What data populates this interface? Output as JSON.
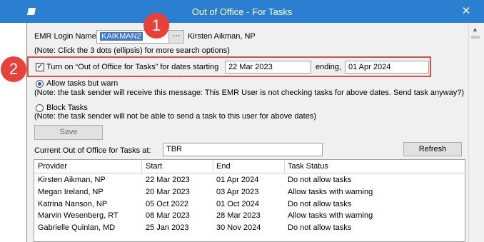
{
  "window": {
    "title": "Out of Office - For Tasks",
    "close_glyph": "✕"
  },
  "login": {
    "label": "EMR Login Name:",
    "value": "KAIKMAN2",
    "ellipsis": "···",
    "user_name": "Kirsten Aikman, NP",
    "note": "(Note: Click the 3 dots (ellipsis) for more search options)"
  },
  "ooo": {
    "checkbox_checked": true,
    "checkbox_label": "Turn on “Out of Office for Tasks” for dates starting",
    "start_date": "22 Mar 2023",
    "ending_label": "ending,",
    "end_date": "01 Apr 2024"
  },
  "options": {
    "allow_label": "Allow tasks but warn",
    "allow_note": "(Note: the task sender will receive this message: This EMR User is not checking tasks for above dates.  Send task anyway?)",
    "block_label": "Block Tasks",
    "block_note": "(Note: the task sender will not be able to send a task to this user for above dates)",
    "selected": "allow"
  },
  "save_label": "Save",
  "current": {
    "label": "Current Out of Office for Tasks at:",
    "value": "TBR",
    "refresh_label": "Refresh"
  },
  "table": {
    "columns": [
      "Provider",
      "Start",
      "End",
      "Task Status"
    ],
    "rows": [
      [
        "Kirsten Aikman, NP",
        "22 Mar 2023",
        "01 Apr 2024",
        "Do not allow tasks"
      ],
      [
        "Megan Ireland, NP",
        "20 Mar 2023",
        "03 Apr 2023",
        "Allow tasks with warning"
      ],
      [
        "Katrina Nanson, NP",
        "05 Oct 2022",
        "01 Oct 2024",
        "Do not allow tasks"
      ],
      [
        "Marvin Wesenberg, RT",
        "08 Mar 2023",
        "28 Mar 2023",
        "Allow tasks with warning"
      ],
      [
        "Gabrielle Quinlan, MD",
        "25 Jan 2023",
        "30 Nov 2024",
        "Do not allow tasks"
      ]
    ]
  },
  "callouts": [
    "1",
    "2"
  ],
  "colors": {
    "titlebar": "#2a7fd0",
    "callout": "#e8413a",
    "highlight_box": "#e0504a",
    "selection": "#3d78d8"
  }
}
